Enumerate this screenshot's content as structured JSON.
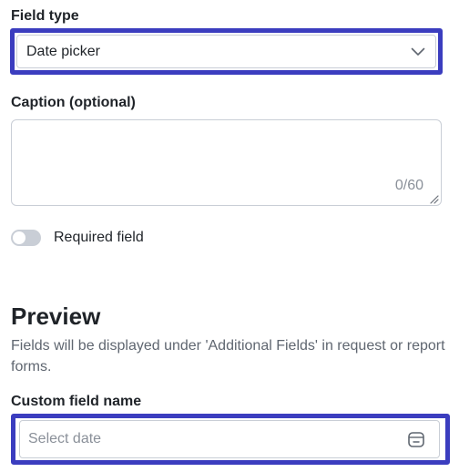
{
  "field_type": {
    "label": "Field type",
    "selected_value": "Date picker"
  },
  "caption": {
    "label": "Caption (optional)",
    "value": "",
    "char_count": "0/60"
  },
  "required_toggle": {
    "label": "Required field",
    "enabled": false
  },
  "preview": {
    "heading": "Preview",
    "description": "Fields will be displayed under 'Additional Fields' in request or report forms.",
    "custom_field_label": "Custom field name",
    "date_placeholder": "Select date"
  },
  "colors": {
    "focus_outline": "#3b3dbf",
    "border": "#c9ced6",
    "muted_text": "#8a9099",
    "toggle_off": "#c9ced6"
  },
  "icons": {
    "select_chevron": "chevron-down-icon",
    "date_picker": "calendar-icon",
    "textarea_resize": "resize-handle-icon"
  }
}
